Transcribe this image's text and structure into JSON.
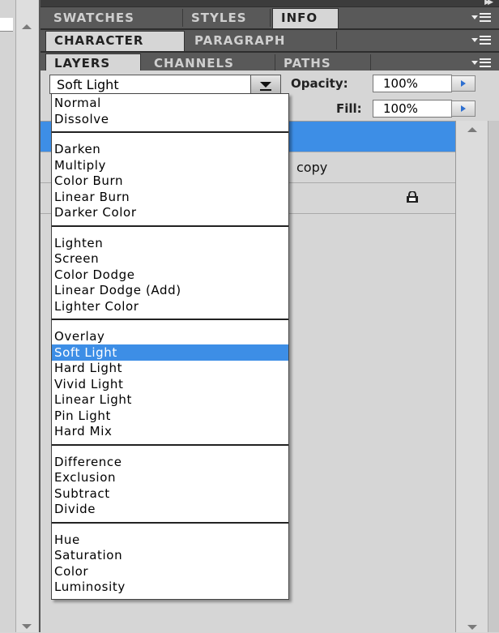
{
  "top_tabs": [
    "SWATCHES",
    "STYLES",
    "INFO"
  ],
  "top_active": "INFO",
  "mid_tabs": [
    "CHARACTER",
    "PARAGRAPH"
  ],
  "layers_tabs": [
    "LAYERS",
    "CHANNELS",
    "PATHS"
  ],
  "blend_mode": {
    "value": "Soft Light"
  },
  "opacity": {
    "label": "Opacity:",
    "value": "100%"
  },
  "fill": {
    "label": "Fill:",
    "value": "100%"
  },
  "layers": [
    {
      "name": "",
      "selected": true,
      "locked": false
    },
    {
      "name": "copy",
      "selected": false,
      "locked": false
    },
    {
      "name": "",
      "selected": false,
      "locked": true
    }
  ],
  "dropdown": {
    "groups": [
      [
        "Normal",
        "Dissolve"
      ],
      [
        "Darken",
        "Multiply",
        "Color Burn",
        "Linear Burn",
        "Darker Color"
      ],
      [
        "Lighten",
        "Screen",
        "Color Dodge",
        "Linear Dodge (Add)",
        "Lighter Color"
      ],
      [
        "Overlay",
        "Soft Light",
        "Hard Light",
        "Vivid Light",
        "Linear Light",
        "Pin Light",
        "Hard Mix"
      ],
      [
        "Difference",
        "Exclusion",
        "Subtract",
        "Divide"
      ],
      [
        "Hue",
        "Saturation",
        "Color",
        "Luminosity"
      ]
    ],
    "selected": "Soft Light"
  },
  "icons": {
    "panel_menu": "panel-menu-icon",
    "collapse": "collapse-panels-icon",
    "lock": "lock-icon"
  },
  "colors": {
    "selection": "#3d8ee6",
    "tab_bar": "#595959",
    "panel_bg": "#d6d6d6"
  }
}
